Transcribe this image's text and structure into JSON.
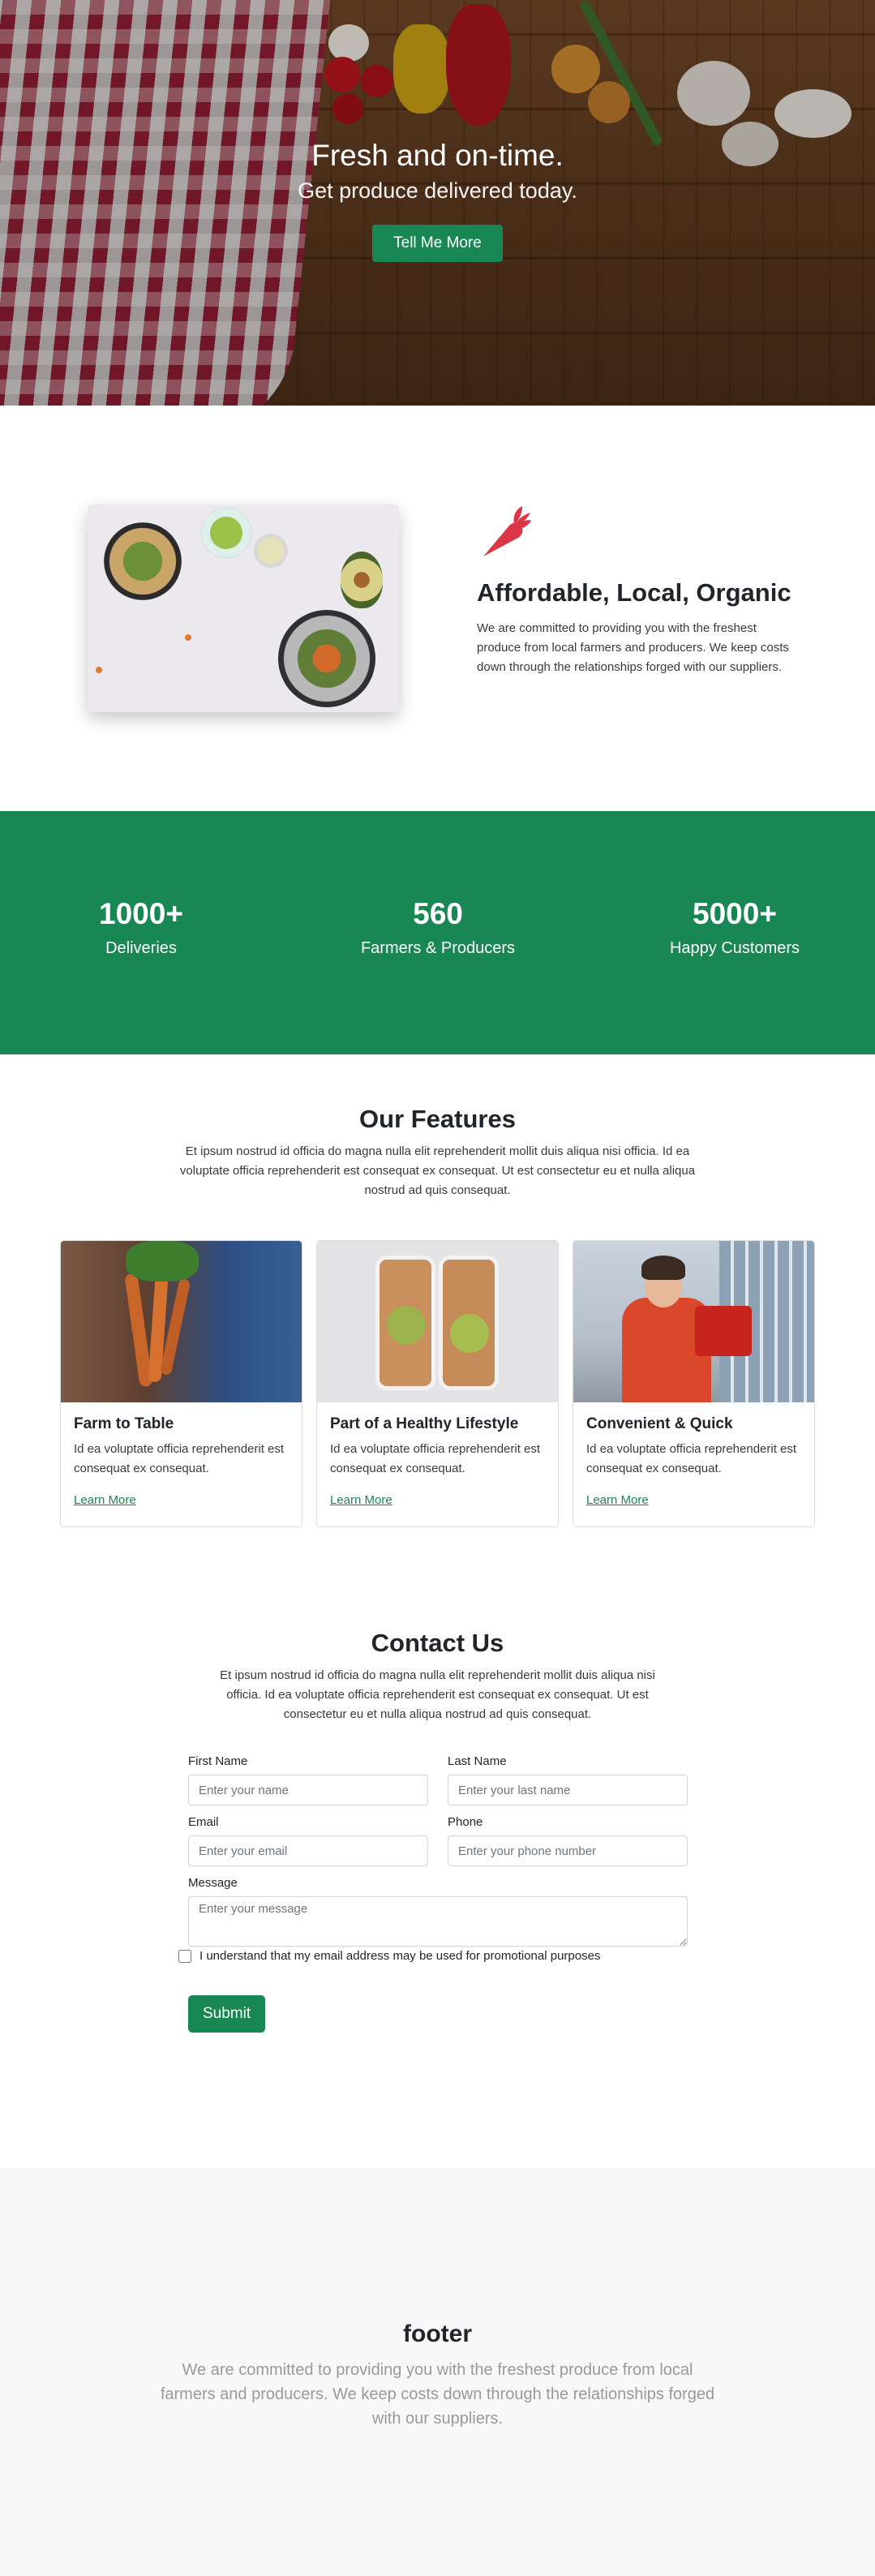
{
  "hero": {
    "title": "Fresh and on-time.",
    "subtitle": "Get produce delivered today.",
    "cta_label": "Tell Me More"
  },
  "about": {
    "icon": "carrot-icon",
    "title": "Affordable, Local, Organic",
    "body": "We are committed to providing you with the freshest produce from local farmers and producers. We keep costs down through the relationships forged with our suppliers."
  },
  "stats": [
    {
      "value": "1000+",
      "label": "Deliveries"
    },
    {
      "value": "560",
      "label": "Farmers & Producers"
    },
    {
      "value": "5000+",
      "label": "Happy Customers"
    }
  ],
  "features": {
    "title": "Our Features",
    "intro": "Et ipsum nostrud id officia do magna nulla elit reprehenderit mollit duis aliqua nisi officia. Id ea voluptate officia reprehenderit est consequat ex consequat. Ut est consectetur eu et nulla aliqua nostrud ad quis consequat.",
    "cards": [
      {
        "title": "Farm to Table",
        "text": "Id ea voluptate officia reprehenderit est consequat ex consequat.",
        "link": "Learn More"
      },
      {
        "title": "Part of a Healthy Lifestyle",
        "text": "Id ea voluptate officia reprehenderit est consequat ex consequat.",
        "link": "Learn More"
      },
      {
        "title": "Convenient & Quick",
        "text": "Id ea voluptate officia reprehenderit est consequat ex consequat.",
        "link": "Learn More"
      }
    ]
  },
  "contact": {
    "title": "Contact Us",
    "intro": "Et ipsum nostrud id officia do magna nulla elit reprehenderit mollit duis aliqua nisi officia. Id ea voluptate officia reprehenderit est consequat ex consequat. Ut est consectetur eu et nulla aliqua nostrud ad quis consequat.",
    "first_name_label": "First Name",
    "first_name_placeholder": "Enter your name",
    "last_name_label": "Last Name",
    "last_name_placeholder": "Enter your last name",
    "email_label": "Email",
    "email_placeholder": "Enter your email",
    "phone_label": "Phone",
    "phone_placeholder": "Enter your phone number",
    "message_label": "Message",
    "message_placeholder": "Enter your message",
    "consent_label": "I understand that my email address may be used for promotional purposes",
    "submit_label": "Submit"
  },
  "footer": {
    "title": "footer",
    "text": "We are committed to providing you with the freshest produce from local farmers and producers. We keep costs down through the relationships forged with our suppliers."
  },
  "colors": {
    "brand_green": "#198754",
    "carrot_red": "#dc3545",
    "footer_bg": "#f8f8f8"
  }
}
